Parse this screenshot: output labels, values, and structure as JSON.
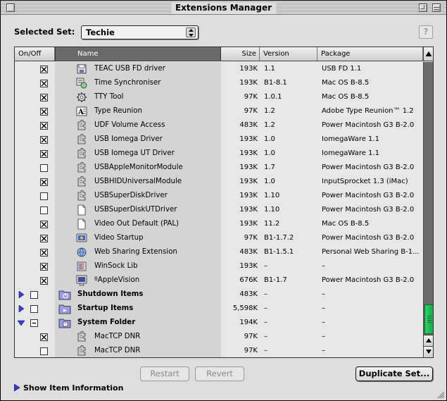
{
  "window": {
    "title": "Extensions Manager"
  },
  "selected_set": {
    "label": "Selected Set:",
    "value": "Techie"
  },
  "help": {
    "label": "?"
  },
  "columns": {
    "onoff": "On/Off",
    "name": "Name",
    "size": "Size",
    "version": "Version",
    "package": "Package"
  },
  "rows": [
    {
      "type": "item",
      "checked": true,
      "name": "TEAC USB FD driver",
      "icon": "disk-driver-icon",
      "size": "193K",
      "version": "1.1",
      "package": "USB FD 1.1"
    },
    {
      "type": "item",
      "checked": true,
      "name": "Time Synchroniser",
      "icon": "control-panel-icon",
      "size": "193K",
      "version": "B1-8.1",
      "package": "Mac OS B-8.5"
    },
    {
      "type": "item",
      "checked": true,
      "name": "TTY Tool",
      "icon": "gear-tool-icon",
      "size": "97K",
      "version": "1.0.1",
      "package": "Mac OS B-8.5"
    },
    {
      "type": "item",
      "checked": true,
      "name": "Type Reunion",
      "icon": "font-extension-icon",
      "size": "97K",
      "version": "1.2",
      "package": "Adobe Type Reunion™ 1.2"
    },
    {
      "type": "item",
      "checked": true,
      "name": "UDF Volume Access",
      "icon": "puzzle-extension-icon",
      "size": "483K",
      "version": "1.2",
      "package": "Power Macintosh G3 B-2.0"
    },
    {
      "type": "item",
      "checked": true,
      "name": "USB Iomega Driver",
      "icon": "puzzle-extension-icon",
      "size": "193K",
      "version": "1.0",
      "package": "IomegaWare 1.1"
    },
    {
      "type": "item",
      "checked": true,
      "name": "USB Iomega UT Driver",
      "icon": "puzzle-extension-icon",
      "size": "193K",
      "version": "1.0",
      "package": "IomegaWare 1.1"
    },
    {
      "type": "item",
      "checked": false,
      "name": "USBAppleMonitorModule",
      "icon": "puzzle-extension-icon",
      "size": "193K",
      "version": "1.7",
      "package": "Power Macintosh G3 B-2.0"
    },
    {
      "type": "item",
      "checked": true,
      "name": "USBHIDUniversalModule",
      "icon": "puzzle-extension-icon",
      "size": "193K",
      "version": "1.0",
      "package": "InputSprocket 1.3 (iMac)"
    },
    {
      "type": "item",
      "checked": false,
      "name": "USBSuperDiskDriver",
      "icon": "puzzle-extension-icon",
      "size": "193K",
      "version": "1.10",
      "package": "Power Macintosh G3 B-2.0"
    },
    {
      "type": "item",
      "checked": false,
      "name": "USBSuperDiskUTDriver",
      "icon": "document-icon",
      "size": "193K",
      "version": "1.10",
      "package": "Power Macintosh G3 B-2.0"
    },
    {
      "type": "item",
      "checked": true,
      "name": "Video Out Default (PAL)",
      "icon": "document-icon",
      "size": "193K",
      "version": "11.2",
      "package": "Mac OS B-8.5"
    },
    {
      "type": "item",
      "checked": true,
      "name": "Video Startup",
      "icon": "video-icon",
      "size": "97K",
      "version": "B1-1.7.2",
      "package": "Power Macintosh G3 B-2.0"
    },
    {
      "type": "item",
      "checked": true,
      "name": "Web Sharing Extension",
      "icon": "web-sharing-icon",
      "size": "483K",
      "version": "B1-1.5.1",
      "package": "Personal Web Sharing B-1..."
    },
    {
      "type": "item",
      "checked": true,
      "name": "WinSock Lib",
      "icon": "library-icon",
      "size": "193K",
      "version": "–",
      "package": "–"
    },
    {
      "type": "item",
      "checked": true,
      "name": "ºAppleVision",
      "icon": "monitor-extension-icon",
      "size": "676K",
      "version": "B1-1.7",
      "package": "Power Macintosh G3 B-2.0"
    },
    {
      "type": "folder",
      "state": "collapsed",
      "checked": "none",
      "name": "Shutdown Items",
      "icon": "shutdown-folder-icon",
      "size": "483K",
      "version": "–",
      "package": "–"
    },
    {
      "type": "folder",
      "state": "collapsed",
      "checked": "none",
      "name": "Startup Items",
      "icon": "startup-folder-icon",
      "size": "5,598K",
      "version": "–",
      "package": "–"
    },
    {
      "type": "folder",
      "state": "expanded",
      "checked": "mixed",
      "name": "System Folder",
      "icon": "system-folder-icon",
      "size": "194K",
      "version": "–",
      "package": "–"
    },
    {
      "type": "item",
      "checked": true,
      "name": "MacTCP DNR",
      "icon": "puzzle-extension-icon",
      "size": "97K",
      "version": "–",
      "package": "–"
    },
    {
      "type": "item",
      "checked": false,
      "name": "MacTCP DNR",
      "icon": "puzzle-extension-icon",
      "size": "97K",
      "version": "–",
      "package": "–"
    }
  ],
  "buttons": {
    "restart": "Restart",
    "revert": "Revert",
    "duplicate": "Duplicate Set..."
  },
  "footer": {
    "show_info": "Show Item Information"
  },
  "colors": {
    "scroll_thumb": "#22c35e",
    "disclosure": "#3a3aff",
    "selected_column": "#6a6a6a"
  }
}
